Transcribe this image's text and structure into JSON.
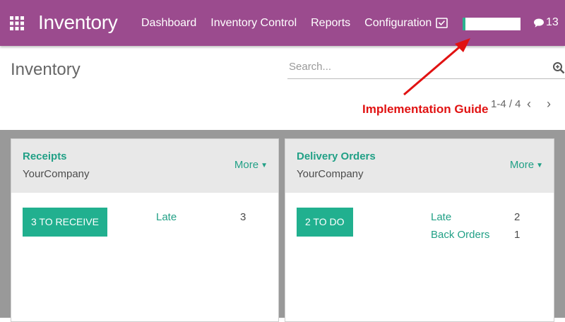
{
  "header": {
    "app_title": "Inventory",
    "nav": [
      "Dashboard",
      "Inventory Control",
      "Reports",
      "Configuration"
    ],
    "chat_count": "13",
    "bar_color": "#9b4b8e"
  },
  "control_panel": {
    "breadcrumb": "Inventory",
    "search_placeholder": "Search...",
    "pager": "1-4 / 4",
    "prev": "‹",
    "next": "›"
  },
  "annotation": {
    "text": "Implementation Guide",
    "color": "#e11212"
  },
  "cards": [
    {
      "title": "Receipts",
      "company": "YourCompany",
      "more": "More",
      "action": "3 TO RECEIVE",
      "stats": [
        {
          "label": "Late",
          "value": "3"
        }
      ]
    },
    {
      "title": "Delivery Orders",
      "company": "YourCompany",
      "more": "More",
      "action": "2 TO DO",
      "stats": [
        {
          "label": "Late",
          "value": "2"
        },
        {
          "label": "Back Orders",
          "value": "1"
        }
      ]
    }
  ],
  "icons": {
    "apps": "grid-icon",
    "mail": "envelope-check-icon",
    "chat": "chat-bubble-icon",
    "search": "magnifier-icon"
  }
}
